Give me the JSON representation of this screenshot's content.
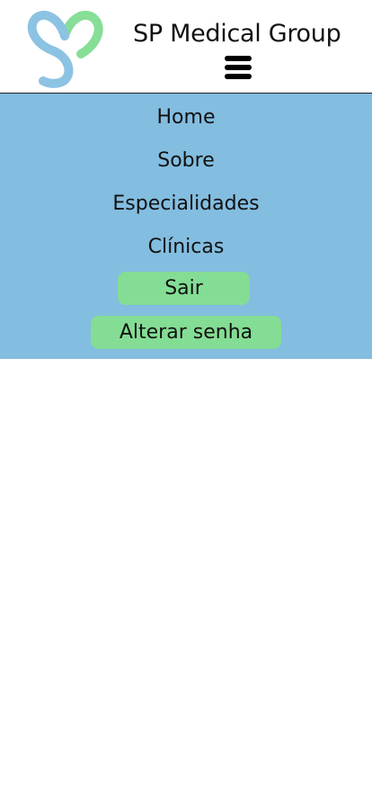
{
  "header": {
    "brand_title": "SP Medical Group",
    "logo_icon": "heart-s-logo-icon",
    "menu_icon": "hamburger-menu-icon"
  },
  "nav": {
    "items": [
      {
        "label": "Home"
      },
      {
        "label": "Sobre"
      },
      {
        "label": "Especialidades"
      },
      {
        "label": "Clínicas"
      }
    ],
    "logout_label": "Sair",
    "change_password_label": "Alterar senha"
  },
  "colors": {
    "nav_background": "#83bde0",
    "button_green": "#84dd94",
    "logo_blue": "#8cc3e3",
    "logo_green": "#86de97"
  }
}
